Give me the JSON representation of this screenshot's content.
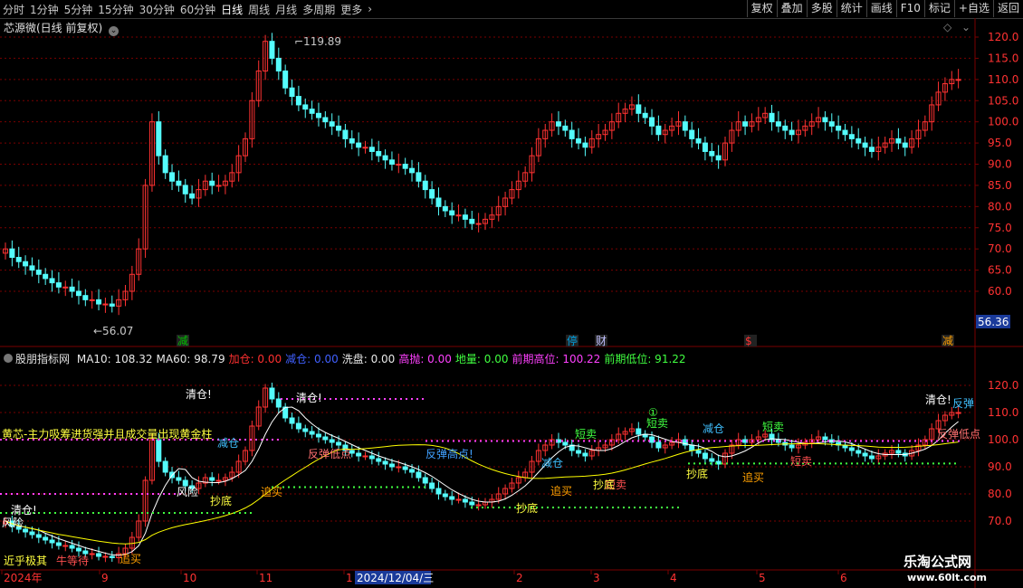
{
  "toolbar": {
    "periods": [
      "分时",
      "1分钟",
      "5分钟",
      "15分钟",
      "30分钟",
      "60分钟",
      "日线",
      "周线",
      "月线",
      "多周期",
      "更多"
    ],
    "active_period": "日线",
    "more_icon": "chevron-right-icon",
    "buttons": [
      "复权",
      "叠加",
      "多股",
      "统计",
      "画线",
      "F10",
      "标记",
      "+自选",
      "返回"
    ]
  },
  "main": {
    "title": "芯源微(日线 前复权)",
    "dropdown_icon": "chevron-down-icon",
    "high_label": "119.89",
    "low_label": "56.07",
    "current_price": "56.36",
    "price_ticks": [
      "120.0",
      "115.0",
      "110.0",
      "105.0",
      "100.0",
      "95.0",
      "90.0",
      "85.0",
      "80.0",
      "75.0",
      "70.0",
      "65.0",
      "60.0"
    ],
    "events": [
      {
        "label": "减",
        "color": "#00c000"
      },
      {
        "label": "停",
        "color": "#00a0e0"
      },
      {
        "label": "财",
        "color": "#c0c0ff"
      },
      {
        "label": "$",
        "color": "#ff3333"
      },
      {
        "label": "减",
        "color": "#ffa000"
      }
    ]
  },
  "indicator": {
    "name": "股朋指标网",
    "params": [
      {
        "label": "MA10: 108.32",
        "color": "#e8e8e8"
      },
      {
        "label": "MA60: 98.79",
        "color": "#e8e8e8"
      },
      {
        "label": "加仓: 0.00",
        "color": "#ff3030"
      },
      {
        "label": "减仓: 0.00",
        "color": "#4060ff"
      },
      {
        "label": "洗盘: 0.00",
        "color": "#e8e8e8"
      },
      {
        "label": "高抛: 0.00",
        "color": "#ff40ff"
      },
      {
        "label": "地量: 0.00",
        "color": "#40ff40"
      },
      {
        "label": "前期高位: 100.22",
        "color": "#ff40ff"
      },
      {
        "label": "前期低位: 91.22",
        "color": "#40ff40"
      }
    ],
    "price_ticks": [
      "120.0",
      "110.0",
      "100.0",
      "90.0",
      "80.0",
      "70.0"
    ],
    "annotation": "黄芯-主力吸筹进货强并且成交量出现黄金柱",
    "signals": [
      "清仓!",
      "清仓!",
      "清仓!",
      "风险",
      "风险",
      "减仓",
      "减仓",
      "减仓",
      "追买",
      "追买",
      "追买",
      "追买",
      "短卖",
      "短卖",
      "短卖",
      "短卖",
      "反弹低点",
      "反弹高点!",
      "反弹低点",
      "反弹",
      "抄底",
      "抄底",
      "抄底",
      "抄底",
      "①",
      "近乎极其",
      "牛等待"
    ],
    "signal_lines": [
      "短卖",
      "清仓!"
    ]
  },
  "axis": {
    "date_labels": [
      "2024年",
      "9",
      "10",
      "11",
      "1",
      "2",
      "3",
      "4",
      "5",
      "6"
    ],
    "cursor_date": "2024/12/04/三"
  },
  "watermark": {
    "name": "乐淘公式网",
    "url": "www.60lt.com"
  },
  "colors": {
    "up": "#ff3232",
    "down": "#54fcfc",
    "ma10": "#ffffff",
    "ma60": "#ffff00",
    "grid": "#7a0000"
  },
  "chart_data": {
    "type": "candlestick",
    "series": [
      {
        "values": [
          70,
          68,
          67,
          66,
          65,
          64,
          63,
          62,
          61,
          61,
          60,
          59,
          58,
          58,
          57,
          57,
          56.5,
          58,
          60,
          64,
          70,
          85,
          100,
          92,
          88,
          86,
          85,
          83,
          82,
          84,
          86,
          85,
          85,
          86,
          88,
          92,
          96,
          105,
          112,
          119,
          115,
          112,
          108,
          106,
          104,
          103,
          102,
          101,
          100,
          99,
          98,
          96,
          95,
          94,
          94,
          93,
          92,
          91,
          90,
          90,
          89,
          88,
          86,
          84,
          82,
          80,
          79,
          78,
          78,
          77,
          76,
          76,
          77,
          78,
          80,
          82,
          84,
          86,
          88,
          92,
          96,
          98,
          100,
          99,
          98,
          96,
          95,
          94,
          96,
          97,
          98,
          100,
          102,
          103,
          104,
          102,
          101,
          99,
          97,
          98,
          99,
          100,
          98,
          96,
          95,
          93,
          92,
          91,
          95,
          98,
          100,
          99,
          100,
          101,
          102,
          100,
          99,
          98,
          97,
          98,
          99,
          100,
          101,
          100,
          99,
          98,
          97,
          96,
          95,
          94,
          93,
          94,
          95,
          96,
          95,
          94,
          96,
          98,
          100,
          104,
          107,
          109,
          110,
          110
        ]
      }
    ]
  }
}
